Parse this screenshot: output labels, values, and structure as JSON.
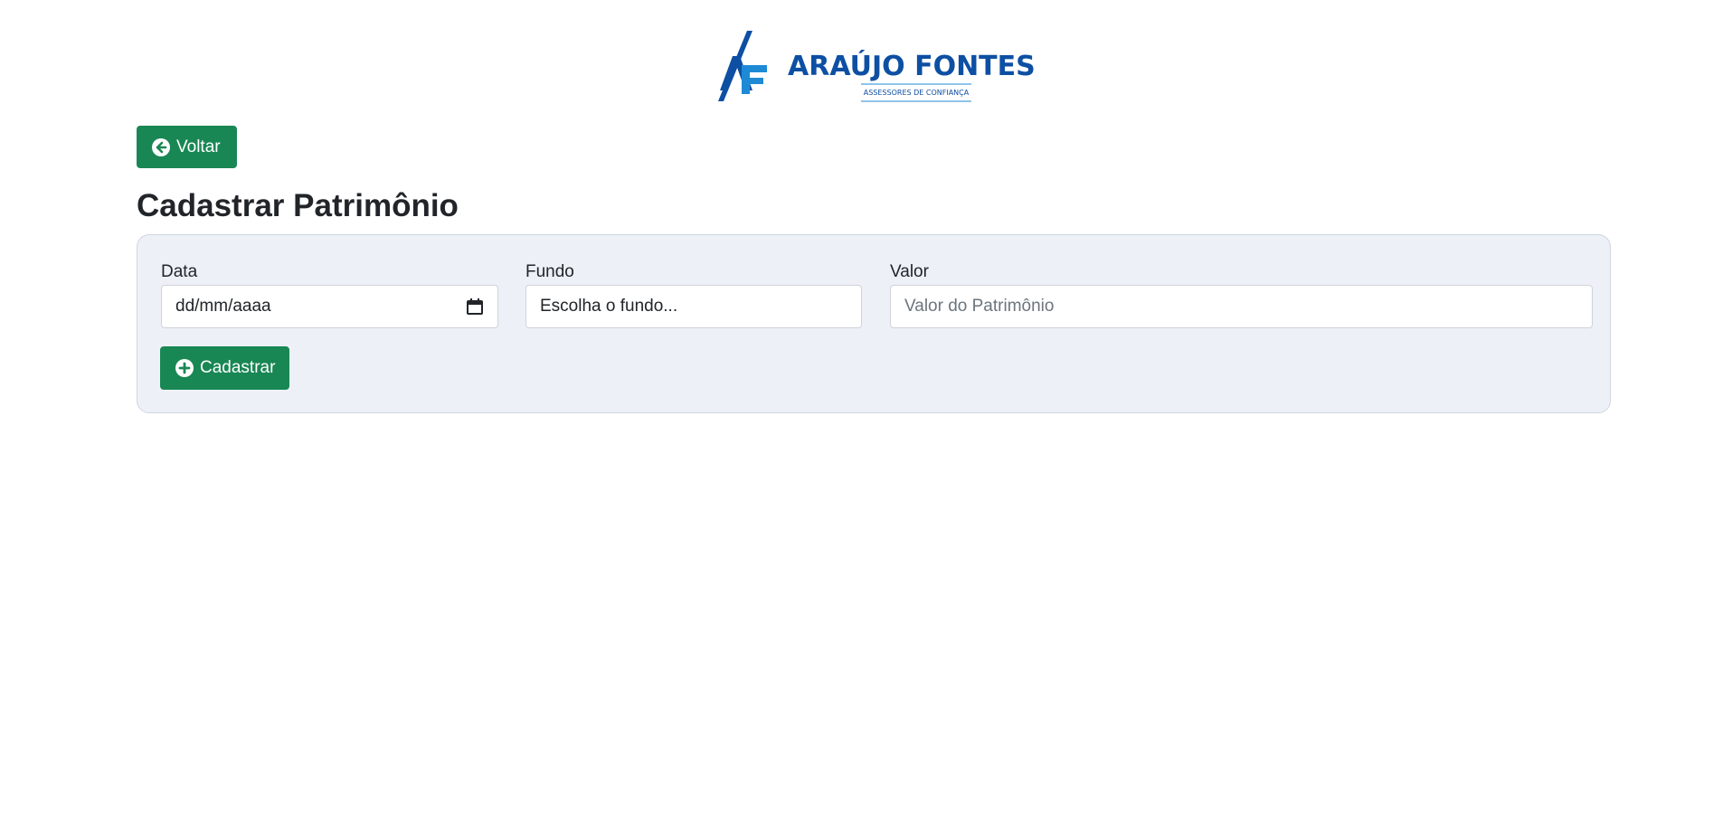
{
  "header": {
    "logo": {
      "brand_name": "ARAÚJO FONTES",
      "tagline": "ASSESSORES DE CONFIANÇA",
      "monogram": "AF",
      "colors": {
        "primary": "#0d4fa3",
        "secondary": "#1e8ad6"
      }
    }
  },
  "toolbar": {
    "back_label": "Voltar",
    "back_icon": "arrow-left-circle-icon"
  },
  "page": {
    "title": "Cadastrar Patrimônio"
  },
  "form": {
    "data": {
      "label": "Data",
      "placeholder": "dd/mm/aaaa",
      "icon": "calendar-icon"
    },
    "fundo": {
      "label": "Fundo",
      "selected": "Escolha o fundo..."
    },
    "valor": {
      "label": "Valor",
      "placeholder": "Valor do Patrimônio"
    },
    "submit": {
      "label": "Cadastrar",
      "icon": "plus-circle-icon"
    }
  },
  "colors": {
    "button": "#198754",
    "card_background": "#edf1f7",
    "card_border": "#cfd6df"
  }
}
